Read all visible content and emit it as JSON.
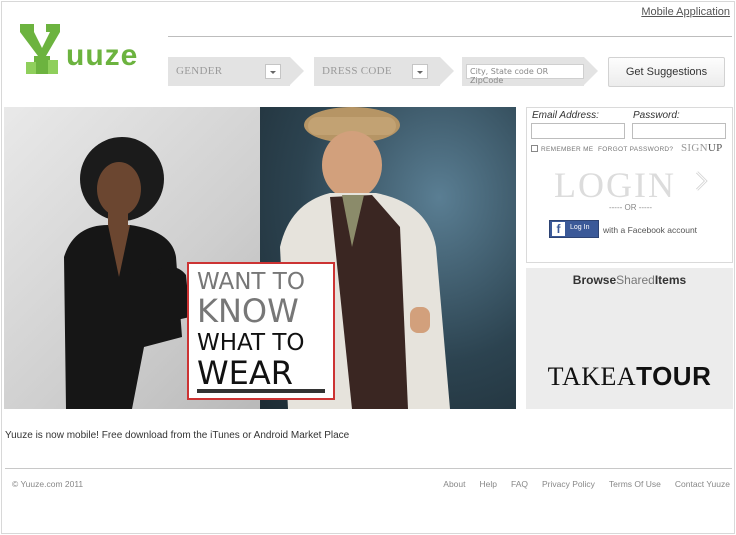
{
  "header": {
    "mobile_link": "Mobile Application",
    "logo_text": "uuze",
    "search": {
      "gender_label": "GENDER",
      "dress_code_label": "DRESS CODE",
      "location_placeholder": "City, State code OR ZipCode",
      "submit_label": "Get Suggestions"
    }
  },
  "hero": {
    "promo": {
      "line1": "WANT TO",
      "line2": "KNOW",
      "line3": "WHAT TO",
      "line4": "WEAR"
    }
  },
  "login": {
    "email_label": "Email Address:",
    "password_label": "Password:",
    "remember_label": "REMEMBER ME",
    "forgot_label": "FORGOT PASSWORD?",
    "signup_pre": "SIGN",
    "signup_post": "UP",
    "login_label": "LOGIN",
    "or_label": "----- OR -----",
    "facebook_button": "Log In",
    "facebook_note": "with a Facebook account"
  },
  "side": {
    "browse_1": "Browse",
    "browse_2": "Shared",
    "browse_3": "Items",
    "tour_1": "TAKE",
    "tour_2": "A",
    "tour_3": "TOUR"
  },
  "notice": "Yuuze is now mobile! Free download from the iTunes or Android Market Place",
  "footer": {
    "copyright": "© Yuuze.com 2011",
    "links": [
      "About",
      "Help",
      "FAQ",
      "Privacy Policy",
      "Terms Of Use",
      "Contact Yuuze"
    ]
  },
  "colors": {
    "brand_green": "#6cb33f",
    "facebook_blue": "#3b5998",
    "promo_border": "#cc3333"
  }
}
